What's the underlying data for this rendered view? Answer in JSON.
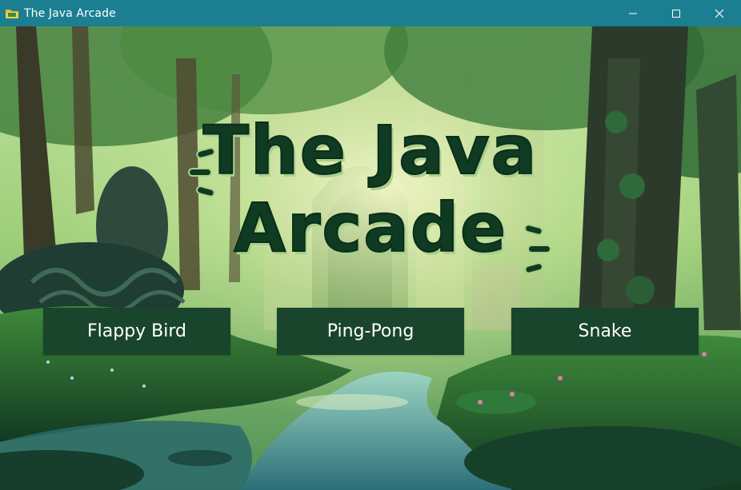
{
  "window": {
    "title": "The Java Arcade",
    "icon": "folder-icon",
    "controls": [
      "minimize-icon",
      "maximize-icon",
      "close-icon"
    ],
    "titlebar_color": "#1b7f91"
  },
  "main": {
    "title_line1": "The Java",
    "title_line2": "Arcade",
    "title_color": "#0f3b22",
    "title_shadow_color": "#a9d08a"
  },
  "menu": {
    "button_color": "#19452c",
    "buttons": [
      {
        "label": "Flappy Bird"
      },
      {
        "label": "Ping-Pong"
      },
      {
        "label": "Snake"
      }
    ]
  }
}
